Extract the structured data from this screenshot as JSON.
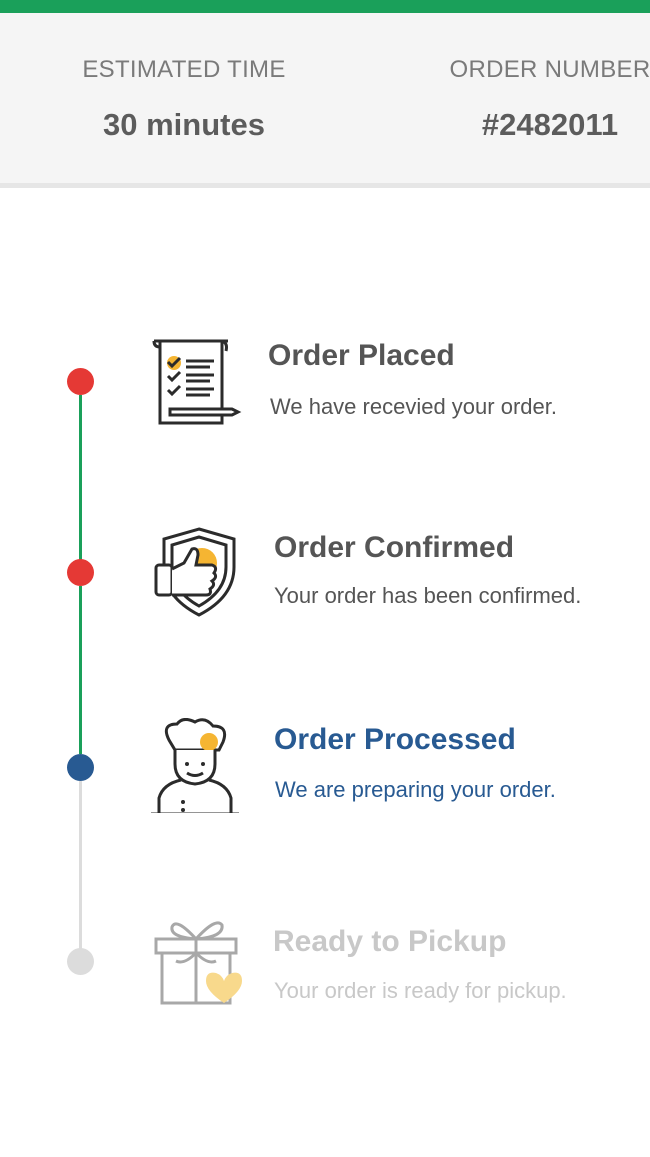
{
  "header": {
    "estimated_time_label": "ESTIMATED TIME",
    "estimated_time_value": "30 minutes",
    "order_number_label": "ORDER NUMBER",
    "order_number_value": "#2482011"
  },
  "colors": {
    "brand_green": "#1aa05a",
    "done_red": "#e53935",
    "current_blue": "#285a92",
    "pending_gray": "#dcdcdc",
    "accent_yellow": "#f5b532"
  },
  "steps": [
    {
      "title": "Order Placed",
      "description": "We have recevied your order.",
      "status": "done",
      "icon": "checklist-icon"
    },
    {
      "title": "Order Confirmed",
      "description": "Your order has been confirmed.",
      "status": "done",
      "icon": "thumbs-up-shield-icon"
    },
    {
      "title": "Order Processed",
      "description": "We are preparing your order.",
      "status": "current",
      "icon": "chef-icon"
    },
    {
      "title": "Ready to Pickup",
      "description": "Your order is ready for pickup.",
      "status": "pending",
      "icon": "gift-box-icon"
    }
  ]
}
